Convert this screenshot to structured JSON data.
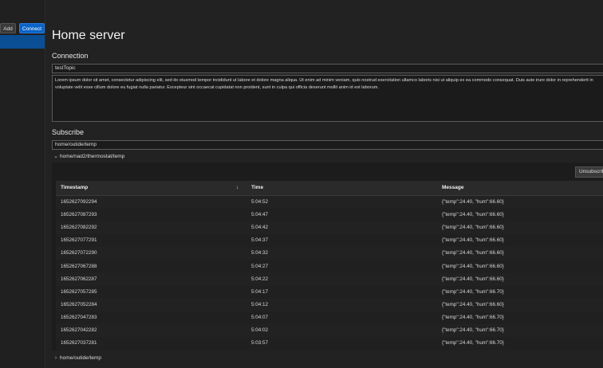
{
  "sidebar": {
    "add_label": "Add",
    "connect_label": "Connect",
    "accent": "#0a64c8"
  },
  "page": {
    "title": "Home server"
  },
  "connection": {
    "heading": "Connection",
    "topic": "testTopic",
    "message": "Lorem ipsum dolor sit amet, consectetur adipiscing elit, sed do eiusmod tempor incididunt ut labore et dolore magna aliqua. Ut enim ad minim veniam, quis nostrud exercitation ullamco laboris nisi ut aliquip ex ea commodo consequat. Duis aute irure dolor in reprehenderit in voluptate velit esse cillum dolore eu fugiat nulla pariatur. Excepteur sint occaecat cupidatat non proident, sunt in culpa qui officia deserunt mollit anim id est laborum."
  },
  "subscribe": {
    "heading": "Subscribe",
    "topic_value": "home/outide/temp",
    "subscriptions": [
      {
        "topic": "home/nad2/thermostat/temp",
        "expanded": true,
        "unsubscribe_label": "Unsubscribe",
        "columns": [
          "Timestamp",
          "Time",
          "Message"
        ],
        "sort_icon": "arrow-down-icon",
        "rows": [
          {
            "timestamp": "1652627092294",
            "time": "5:04:52",
            "message": "{\"temp\":24.40, \"hum\":66.60}"
          },
          {
            "timestamp": "1652627087293",
            "time": "5:04:47",
            "message": "{\"temp\":24.40, \"hum\":66.60}"
          },
          {
            "timestamp": "1652627082292",
            "time": "5:04:42",
            "message": "{\"temp\":24.40, \"hum\":66.60}"
          },
          {
            "timestamp": "1652627077291",
            "time": "5:04:37",
            "message": "{\"temp\":24.40, \"hum\":66.60}"
          },
          {
            "timestamp": "1652627072290",
            "time": "5:04:32",
            "message": "{\"temp\":24.40, \"hum\":66.60}"
          },
          {
            "timestamp": "1652627067288",
            "time": "5:04:27",
            "message": "{\"temp\":24.40, \"hum\":66.60}"
          },
          {
            "timestamp": "1652627062287",
            "time": "5:04:22",
            "message": "{\"temp\":24.40, \"hum\":66.60}"
          },
          {
            "timestamp": "1652627057285",
            "time": "5:04:17",
            "message": "{\"temp\":24.40, \"hum\":66.70}"
          },
          {
            "timestamp": "1652627052284",
            "time": "5:04:12",
            "message": "{\"temp\":24.40, \"hum\":66.60}"
          },
          {
            "timestamp": "1652627047283",
            "time": "5:04:07",
            "message": "{\"temp\":24.40, \"hum\":66.70}"
          },
          {
            "timestamp": "1652627042282",
            "time": "5:04:02",
            "message": "{\"temp\":24.40, \"hum\":66.70}"
          },
          {
            "timestamp": "1652627037281",
            "time": "5:03:57",
            "message": "{\"temp\":24.40, \"hum\":66.70}"
          }
        ]
      },
      {
        "topic": "home/outide/temp",
        "expanded": false
      }
    ]
  }
}
